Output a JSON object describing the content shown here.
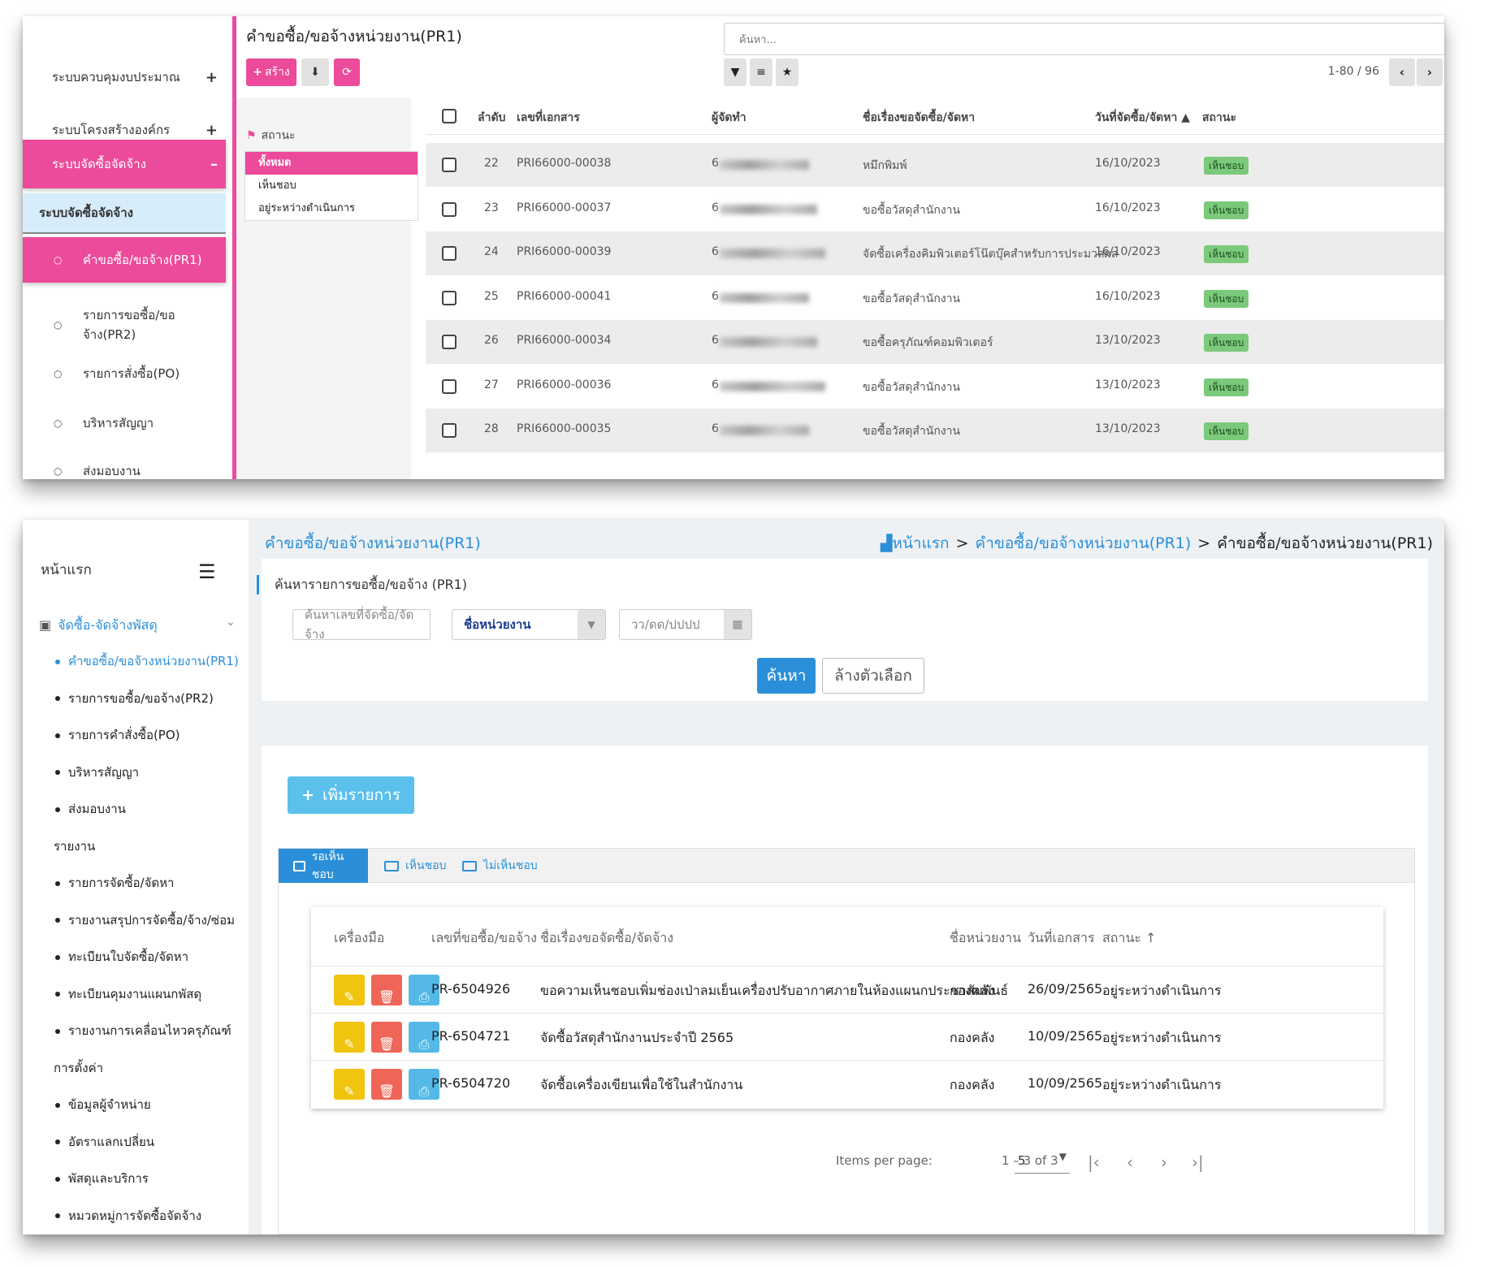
{
  "top": {
    "sidebar": {
      "sections": [
        {
          "label": "ระบบควบคุมงบประมาณ",
          "icon": "+"
        },
        {
          "label": "ระบบโครงสร้างองค์กร",
          "icon": "+"
        },
        {
          "label": "ระบบจัดซื้อจัดจ้าง",
          "icon": "–"
        }
      ],
      "sub_header": "ระบบจัดซื้อจัดจ้าง",
      "items": [
        "คำขอซื้อ/ขอจ้าง(PR1)",
        "รายการขอซื้อ/ขอจ้าง(PR2)",
        "รายการสั่งซื้อ(PO)",
        "บริหารสัญญา",
        "ส่งมอบงาน"
      ]
    },
    "title": "คำขอซื้อ/ขอจ้างหน่วยงาน(PR1)",
    "create_label": "สร้าง",
    "search_placeholder": "ค้นหา...",
    "pager": "1-80 / 96",
    "filter": {
      "heading": "สถานะ",
      "options": [
        "ทั้งหมด",
        "เห็นชอบ",
        "อยู่ระหว่างดำเนินการ"
      ]
    },
    "columns": {
      "seq": "ลำดับ",
      "doc_no": "เลขที่เอกสาร",
      "requester": "ผู้จัดทำ",
      "subject": "ชื่อเรื่องขอจัดซื้อ/จัดหา",
      "date": "วันที่จัดซื้อ/จัดหา ▲",
      "status": "สถานะ"
    },
    "rows": [
      {
        "seq": "22",
        "doc": "PRI66000-00038",
        "req": "6",
        "subject": "หมึกพิมพ์",
        "date": "16/10/2023",
        "status": "เห็นชอบ"
      },
      {
        "seq": "23",
        "doc": "PRI66000-00037",
        "req": "6",
        "subject": "ขอซื้อวัสดุสำนักงาน",
        "date": "16/10/2023",
        "status": "เห็นชอบ"
      },
      {
        "seq": "24",
        "doc": "PRI66000-00039",
        "req": "6",
        "subject": "จัดซื้อเครื่องคิมพิวเตอร์โน๊ตบุ๊คสำหรับการประมวลผล",
        "date": "16/10/2023",
        "status": "เห็นชอบ"
      },
      {
        "seq": "25",
        "doc": "PRI66000-00041",
        "req": "6",
        "subject": "ขอซื้อวัสดุสำนักงาน",
        "date": "16/10/2023",
        "status": "เห็นชอบ"
      },
      {
        "seq": "26",
        "doc": "PRI66000-00034",
        "req": "6",
        "subject": "ขอซื้อครุภัณฑ์คอมพิวเตอร์",
        "date": "13/10/2023",
        "status": "เห็นชอบ"
      },
      {
        "seq": "27",
        "doc": "PRI66000-00036",
        "req": "6",
        "subject": "ขอซื้อวัสดุสำนักงาน",
        "date": "13/10/2023",
        "status": "เห็นชอบ"
      },
      {
        "seq": "28",
        "doc": "PRI66000-00035",
        "req": "6",
        "subject": "ขอซื้อวัสดุสำนักงาน",
        "date": "13/10/2023",
        "status": "เห็นชอบ"
      }
    ]
  },
  "bottom": {
    "sidebar": {
      "home": "หน้าแรก",
      "group": "จัดซื้อ-จัดจ้างพัสดุ",
      "items": [
        "คำขอซื้อ/ขอจ้างหน่วยงาน(PR1)",
        "รายการขอซื้อ/ขอจ้าง(PR2)",
        "รายการคำสั่งซื้อ(PO)",
        "บริหารสัญญา",
        "ส่งมอบงาน"
      ],
      "report_heading": "รายงาน",
      "reports": [
        "รายการจัดซื้อ/จัดหา",
        "รายงานสรุปการจัดซื้อ/จ้าง/ซ่อม",
        "ทะเบียนใบจัดซื้อ/จัดหา",
        "ทะเบียนคุมงานแผนกพัสดุ",
        "รายงานการเคลื่อนไหวครุภัณฑ์"
      ],
      "settings_heading": "การตั้งค่า",
      "settings": [
        "ข้อมูลผู้จำหน่าย",
        "อัตราแลกเปลี่ยน",
        "พัสดุและบริการ",
        "หมวดหมู่การจัดซื้อจัดจ้าง"
      ]
    },
    "title": "คำขอซื้อ/ขอจ้างหน่วยงาน(PR1)",
    "breadcrumb": [
      "หน้าแรก",
      "คำขอซื้อ/ขอจ้างหน่วยงาน(PR1)",
      "คำขอซื้อ/ขอจ้างหน่วยงาน(PR1)"
    ],
    "search_card": {
      "title": "ค้นหารายการขอซื้อ/ขอจ้าง (PR1)",
      "doc_placeholder": "ค้นหาเลขที่จัดซื้อ/จัดจ้าง",
      "unit_select": "ชื่อหน่วยงาน",
      "date_placeholder": "วว/ดด/ปปปป",
      "search_btn": "ค้นหา",
      "clear_btn": "ล้างตัวเลือก"
    },
    "add_btn": "เพิ่มรายการ",
    "tabs": [
      "รอเห็นชอบ",
      "เห็นชอบ",
      "ไม่เห็นชอบ"
    ],
    "columns": {
      "tools": "เครื่องมือ",
      "doc_no": "เลขที่ขอซื้อ/ขอจ้าง",
      "subject": "ชื่อเรื่องขอจัดซื้อ/จัดจ้าง",
      "unit": "ชื่อหน่วยงาน",
      "date": "วันที่เอกสาร",
      "status": "สถานะ ↑"
    },
    "rows": [
      {
        "doc": "PR-6504926",
        "subject": "ขอความเห็นชอบเพิ่มช่องเป่าลมเย็นเครื่องปรับอากาศภายในห้องแผนกประชาสัมพันธ์",
        "unit": "กองคลัง",
        "date": "26/09/2565",
        "status": "อยู่ระหว่างดำเนินการ"
      },
      {
        "doc": "PR-6504721",
        "subject": "จัดซื้อวัสดุสำนักงานประจำปี 2565",
        "unit": "กองคลัง",
        "date": "10/09/2565",
        "status": "อยู่ระหว่างดำเนินการ"
      },
      {
        "doc": "PR-6504720",
        "subject": "จัดซื้อเครื่องเขียนเพื่อใช้ในสำนักงาน",
        "unit": "กองคลัง",
        "date": "10/09/2565",
        "status": "อยู่ระหว่างดำเนินการ"
      }
    ],
    "paginator": {
      "items_per_page_label": "Items per page:",
      "items_per_page": "5",
      "range": "1 – 3 of 3"
    }
  },
  "colors": {
    "pink": "#ec4a9a",
    "blue": "#2a8fd8",
    "green_badge": "#7bc97b"
  }
}
